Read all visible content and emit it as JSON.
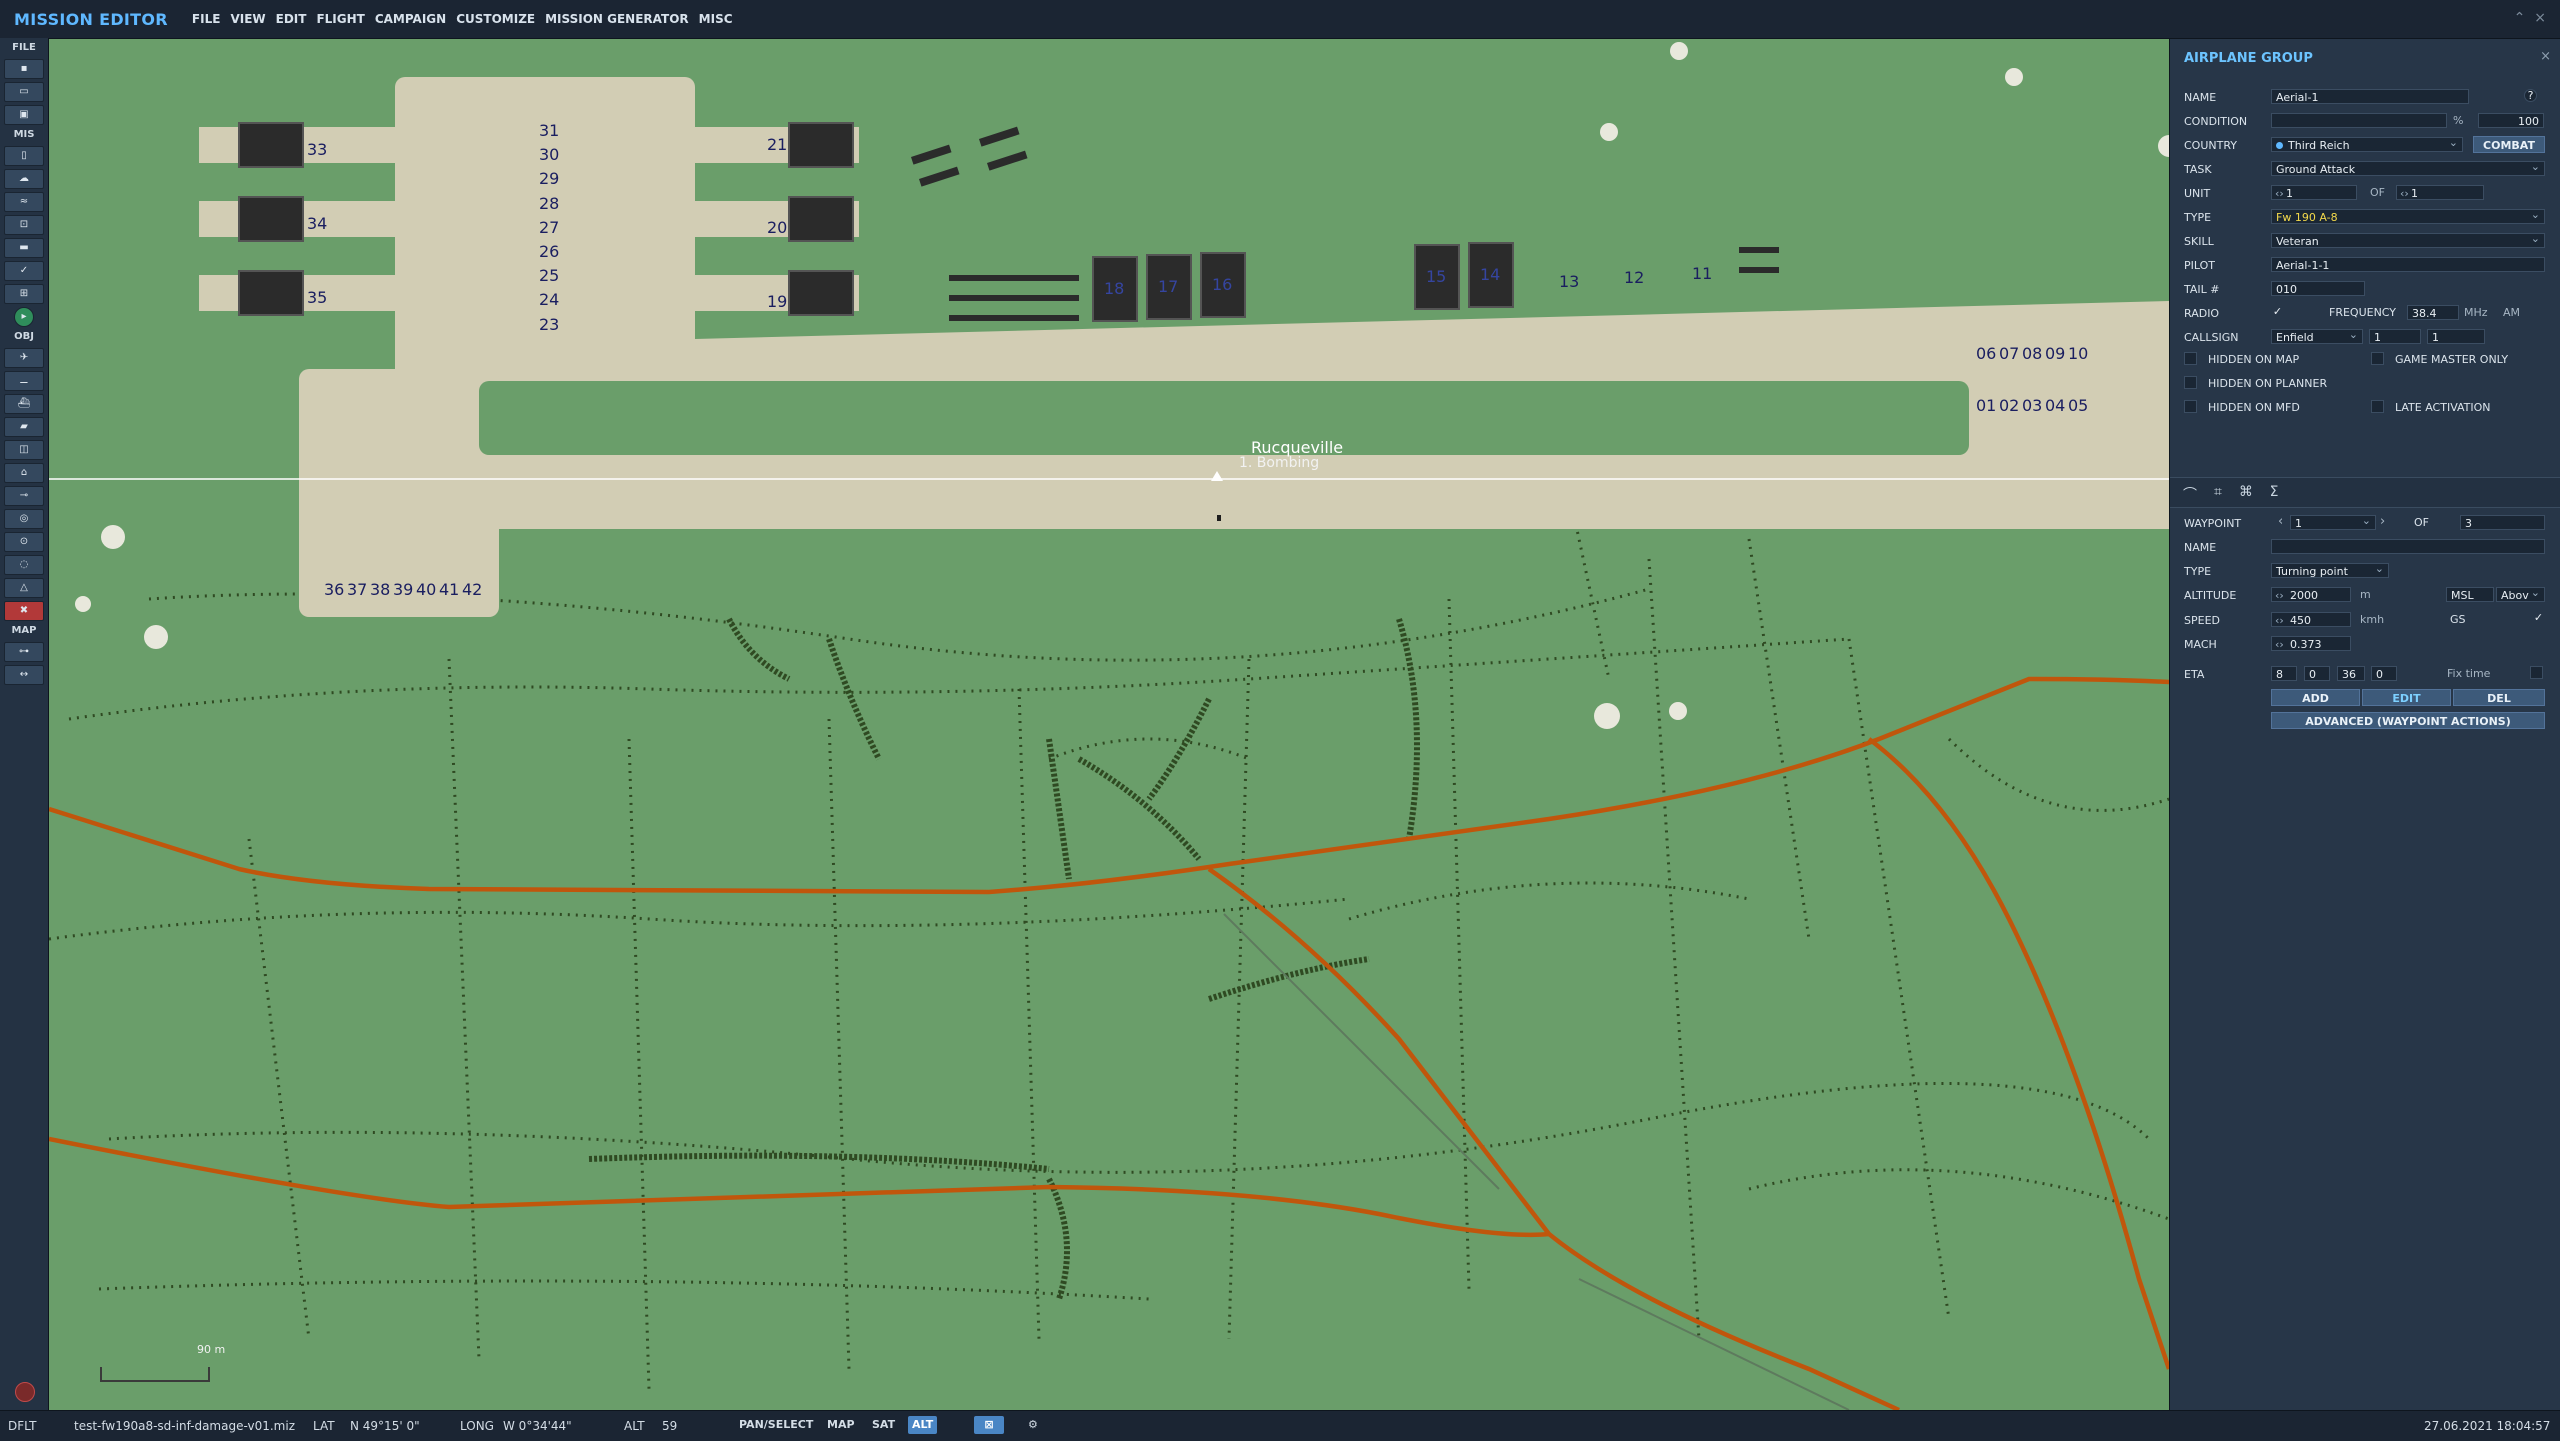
{
  "app": {
    "title": "MISSION EDITOR",
    "close_glyph": "×",
    "minimize_glyph": "⌃"
  },
  "menu": [
    "FILE",
    "VIEW",
    "EDIT",
    "FLIGHT",
    "CAMPAIGN",
    "CUSTOMIZE",
    "MISSION GENERATOR",
    "MISC"
  ],
  "toolbar": {
    "sections": {
      "file": "FILE",
      "mis": "MIS",
      "obj": "OBJ",
      "map": "MAP"
    }
  },
  "map": {
    "airfield_name": "Rucqueville",
    "waypoint_label": "1. Bombing",
    "scale_label": "90 m",
    "parking_left": [
      "33",
      "34",
      "35"
    ],
    "parking_left_inner": [
      "21",
      "20",
      "19"
    ],
    "parking_center": [
      "31",
      "30",
      "29",
      "28",
      "27",
      "26",
      "25",
      "24",
      "23"
    ],
    "parking_bottom": [
      "36",
      "37",
      "38",
      "39",
      "40",
      "41",
      "42"
    ],
    "hangars_mid": [
      "18",
      "17",
      "16"
    ],
    "hangars_right": [
      "15",
      "14"
    ],
    "parking_runway": [
      "13",
      "12",
      "11"
    ],
    "parking_east_top": [
      "06",
      "07",
      "08",
      "09",
      "10"
    ],
    "parking_east_bot": [
      "01",
      "02",
      "03",
      "04",
      "05"
    ]
  },
  "panel": {
    "title": "AIRPLANE GROUP",
    "close": "×",
    "name_label": "NAME",
    "name_value": "Aerial-1",
    "help": "?",
    "condition_label": "CONDITION",
    "condition_pct": "%",
    "condition_value": "100",
    "country_label": "COUNTRY",
    "country_value": "Third Reich",
    "combat_button": "COMBAT",
    "task_label": "TASK",
    "task_value": "Ground Attack",
    "unit_label": "UNIT",
    "unit_value": "1",
    "unit_of": "OF",
    "unit_total": "1",
    "type_label": "TYPE",
    "type_value": "Fw 190 A-8",
    "skill_label": "SKILL",
    "skill_value": "Veteran",
    "pilot_label": "PILOT",
    "pilot_value": "Aerial-1-1",
    "tail_label": "TAIL #",
    "tail_value": "010",
    "radio_label": "RADIO",
    "frequency_label": "FREQUENCY",
    "frequency_value": "38.4",
    "frequency_unit": "MHz",
    "modulation": "AM",
    "callsign_label": "CALLSIGN",
    "callsign_value": "Enfield",
    "callsign_num1": "1",
    "callsign_num2": "1",
    "hidden_on_map": "HIDDEN ON MAP",
    "game_master_only": "GAME MASTER ONLY",
    "hidden_on_planner": "HIDDEN ON PLANNER",
    "late_activation": "LATE ACTIVATION",
    "hidden_on_mfd": "HIDDEN ON MFD",
    "check_mark": "✓",
    "waypoint": {
      "label": "WAYPOINT",
      "value": "1",
      "of": "OF",
      "total": "3",
      "name_label": "NAME",
      "name_value": "",
      "type_label": "TYPE",
      "type_value": "Turning point",
      "altitude_label": "ALTITUDE",
      "altitude_value": "2000",
      "altitude_unit": "m",
      "alt_ref": "MSL",
      "alt_mode": "Abov",
      "speed_label": "SPEED",
      "speed_value": "450",
      "speed_unit": "kmh",
      "gs_label": "GS",
      "mach_label": "MACH",
      "mach_value": "0.373",
      "eta_label": "ETA",
      "eta_d": "8",
      "eta_h": "0",
      "eta_m": "36",
      "eta_s": "0",
      "fix_time": "Fix time",
      "add": "ADD",
      "edit": "EDIT",
      "del": "DEL",
      "advanced": "ADVANCED (WAYPOINT ACTIONS)"
    }
  },
  "status": {
    "profile": "DFLT",
    "filename": "test-fw190a8-sd-inf-damage-v01.miz",
    "lat_label": "LAT",
    "lat_value": "N 49°15' 0\"",
    "long_label": "LONG",
    "long_value": "W  0°34'44\"",
    "alt_label": "ALT",
    "alt_value": "59",
    "pan_select": "PAN/SELECT",
    "map_btn": "MAP",
    "sat_btn": "SAT",
    "alt_btn": "ALT",
    "datetime": "27.06.2021 18:04:57"
  },
  "colors": {
    "map_green": "#6a9e6a",
    "concrete": "#d2cdb4",
    "road": "#c0560c",
    "tree": "#2f4a22",
    "accent": "#5fb8ff"
  }
}
